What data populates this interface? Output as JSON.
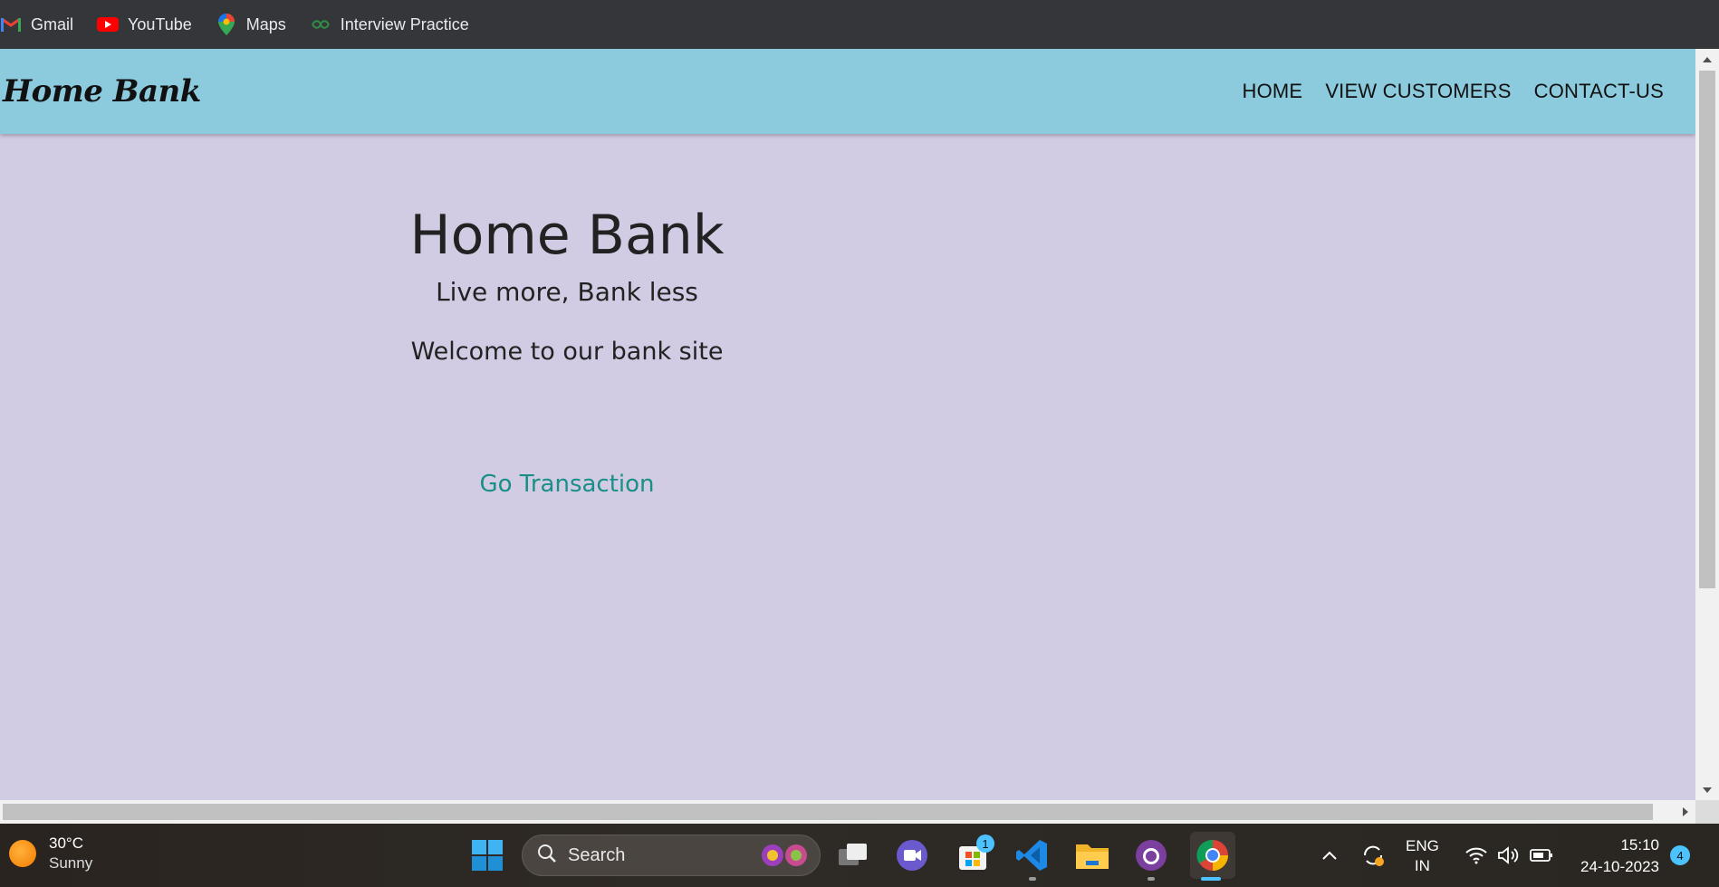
{
  "bookmarks": [
    {
      "label": "Gmail",
      "icon": "gmail-icon"
    },
    {
      "label": "YouTube",
      "icon": "youtube-icon"
    },
    {
      "label": "Maps",
      "icon": "maps-icon"
    },
    {
      "label": "Interview Practice",
      "icon": "interview-practice-icon"
    }
  ],
  "navbar": {
    "brand": "Home Bank",
    "links": [
      "HOME",
      "VIEW CUSTOMERS",
      "CONTACT-US"
    ]
  },
  "hero": {
    "title": "Home Bank",
    "tagline": "Live more, Bank less",
    "welcome": "Welcome to our bank site",
    "cta": "Go Transaction"
  },
  "taskbar": {
    "weather_temp": "30°C",
    "weather_desc": "Sunny",
    "search_label": "Search",
    "store_badge": "1",
    "lang_line1": "ENG",
    "lang_line2": "IN",
    "time": "15:10",
    "date": "24-10-2023",
    "notifications": "4"
  },
  "colors": {
    "page_bg": "#d1cce4",
    "navbar_bg": "#8ccade",
    "cta": "#1a8f88"
  }
}
